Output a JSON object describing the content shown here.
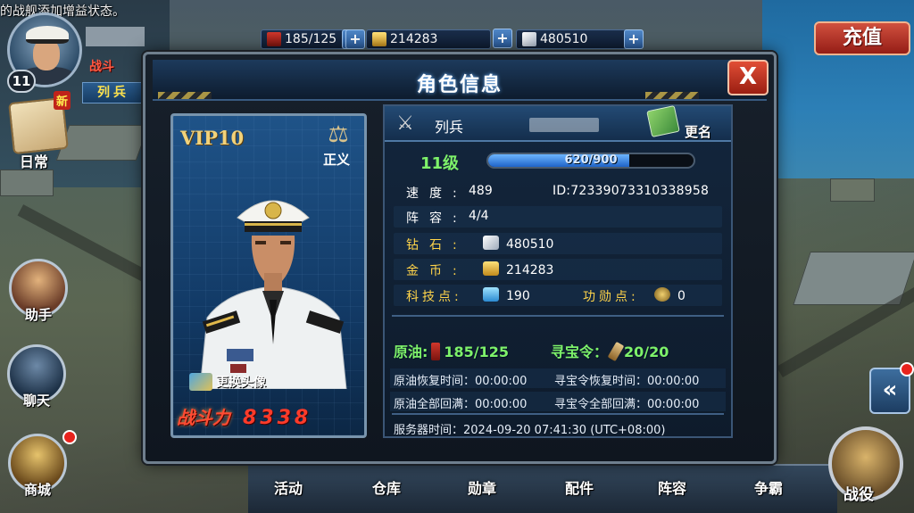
{
  "top_notice": "的战舰添加增益状态。",
  "resources": {
    "oil": "185/125",
    "gold": "214283",
    "diamond": "480510"
  },
  "recharge_label": "充值",
  "hud": {
    "level": "11",
    "power_label": "战斗",
    "rank": "列兵",
    "daily_new": "新",
    "daily_label": "日常",
    "assistant_label": "助手",
    "chat_label": "聊天",
    "shop_label": "商城"
  },
  "bottom_menu": [
    "活动",
    "仓库",
    "勋章",
    "配件",
    "阵容",
    "争霸"
  ],
  "battle_label": "战役",
  "collapse_label": "«",
  "dialog": {
    "title": "角色信息",
    "close_label": "X",
    "portrait": {
      "vip": "VIP10",
      "alignment": "正义",
      "change_avatar": "更换头像",
      "power_label": "战斗力",
      "power_value": "8338"
    },
    "info": {
      "rank": "列兵",
      "rename": "更名",
      "level": "11级",
      "exp_text": "620/900",
      "exp_fraction": 0.689,
      "speed_label": "速度:",
      "speed_value": "489",
      "id_text": "ID:72339073310338958",
      "formation_label": "阵容:",
      "formation_value": "4/4",
      "diamond_label": "钻石:",
      "diamond_value": "480510",
      "gold_label": "金币:",
      "gold_value": "214283",
      "tech_label": "科技点:",
      "tech_value": "190",
      "merit_label": "功勋点:",
      "merit_value": "0",
      "oil_label": "原油:",
      "oil_value": "185/125",
      "treasure_label": "寻宝令：",
      "treasure_value": "20/20",
      "oil_recover": "原油恢复时间：00:00:00",
      "treasure_recover": "寻宝令恢复时间：00:00:00",
      "oil_full": "原油全部回满：00:00:00",
      "treasure_full": "寻宝令全部回满：00:00:00",
      "server_time": "服务器时间：2024-09-20 07:41:30 (UTC+08:00)"
    }
  },
  "colors": {
    "accent_green": "#7ef26a",
    "gold_label": "#ffd44a",
    "power_red": "#ff3b2a",
    "close_red": "#d2402c"
  }
}
